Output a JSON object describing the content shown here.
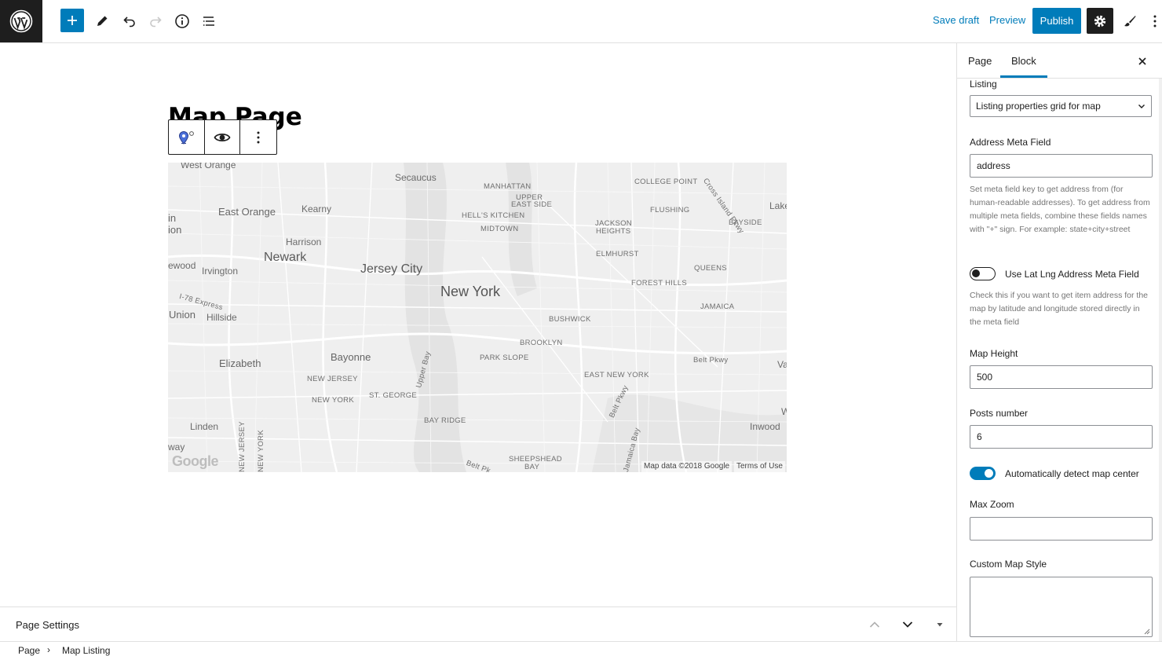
{
  "toolbar": {
    "save_draft": "Save draft",
    "preview": "Preview",
    "publish": "Publish"
  },
  "editor": {
    "page_title": "Map Page"
  },
  "map": {
    "labels": [
      {
        "text": "West Orange",
        "cls": "mid"
      },
      {
        "text": "Secaucus",
        "cls": ""
      },
      {
        "text": "MANHATTAN",
        "cls": "hood"
      },
      {
        "text": "UPPER",
        "cls": "hood"
      },
      {
        "text": "EAST SIDE",
        "cls": "hood"
      },
      {
        "text": "COLLEGE POINT",
        "cls": "hood"
      },
      {
        "text": "Cross Island Pkwy",
        "cls": "hood"
      },
      {
        "text": "Lake",
        "cls": ""
      },
      {
        "text": "in",
        "cls": "mid"
      },
      {
        "text": "ion",
        "cls": "mid"
      },
      {
        "text": "East Orange",
        "cls": "mid"
      },
      {
        "text": "Kearny",
        "cls": ""
      },
      {
        "text": "HELL'S KITCHEN",
        "cls": "hood"
      },
      {
        "text": "MIDTOWN",
        "cls": "hood"
      },
      {
        "text": "FLUSHING",
        "cls": "hood"
      },
      {
        "text": "JACKSON",
        "cls": "hood"
      },
      {
        "text": "HEIGHTS",
        "cls": "hood"
      },
      {
        "text": "BAYSIDE",
        "cls": "hood"
      },
      {
        "text": "Harrison",
        "cls": ""
      },
      {
        "text": "Newark",
        "cls": "city"
      },
      {
        "text": "ELMHURST",
        "cls": "hood"
      },
      {
        "text": "ewood",
        "cls": ""
      },
      {
        "text": "Irvington",
        "cls": ""
      },
      {
        "text": "Jersey City",
        "cls": "city"
      },
      {
        "text": "QUEENS",
        "cls": "hood"
      },
      {
        "text": "FOREST HILLS",
        "cls": "hood"
      },
      {
        "text": "New York",
        "cls": "big"
      },
      {
        "text": "I-78 Express",
        "cls": "hood"
      },
      {
        "text": "JAMAICA",
        "cls": "hood"
      },
      {
        "text": "Union",
        "cls": "mid"
      },
      {
        "text": "Hillside",
        "cls": ""
      },
      {
        "text": "BUSHWICK",
        "cls": "hood"
      },
      {
        "text": "BROOKLYN",
        "cls": "hood"
      },
      {
        "text": "Elizabeth",
        "cls": "mid"
      },
      {
        "text": "Bayonne",
        "cls": "mid"
      },
      {
        "text": "PARK SLOPE",
        "cls": "hood"
      },
      {
        "text": "Upper Bay",
        "cls": "hood"
      },
      {
        "text": "Belt Pkwy",
        "cls": "hood"
      },
      {
        "text": "Va",
        "cls": ""
      },
      {
        "text": "NEW JERSEY",
        "cls": "hood"
      },
      {
        "text": "EAST NEW YORK",
        "cls": "hood"
      },
      {
        "text": "NEW YORK",
        "cls": "hood"
      },
      {
        "text": "ST. GEORGE",
        "cls": "hood"
      },
      {
        "text": "Belt Pkwy",
        "cls": "hood"
      },
      {
        "text": "W",
        "cls": ""
      },
      {
        "text": "BAY RIDGE",
        "cls": "hood"
      },
      {
        "text": "Linden",
        "cls": ""
      },
      {
        "text": "Inwood",
        "cls": ""
      },
      {
        "text": "way",
        "cls": ""
      },
      {
        "text": "NEW JERSEY",
        "cls": "hood"
      },
      {
        "text": "NEW YORK",
        "cls": "hood"
      },
      {
        "text": "Jamaica Bay",
        "cls": "hood"
      },
      {
        "text": "SHEEPSHEAD",
        "cls": "hood"
      },
      {
        "text": "BAY",
        "cls": "hood"
      },
      {
        "text": "Belt Pk",
        "cls": "hood"
      }
    ],
    "google_logo": "Google",
    "attribution": "Map data ©2018 Google",
    "terms": "Terms of Use"
  },
  "bottom": {
    "page_settings": "Page Settings",
    "breadcrumb_page": "Page",
    "breadcrumb_current": "Map Listing"
  },
  "sidebar": {
    "tab_page": "Page",
    "tab_block": "Block",
    "listing_label": "Listing",
    "listing_value": "Listing properties grid for map",
    "address_label": "Address Meta Field",
    "address_value": "address",
    "address_help": "Set meta field key to get address from (for human-readable addresses). To get address from multiple meta fields, combine these fields names with \"+\" sign. For example: state+city+street",
    "latlng_label": "Use Lat Lng Address Meta Field",
    "latlng_help": "Check this if you want to get item address for the map by latitude and longitude stored directly in the meta field",
    "height_label": "Map Height",
    "height_value": "500",
    "posts_label": "Posts number",
    "posts_value": "6",
    "autocenter_label": "Automatically detect map center",
    "maxzoom_label": "Max Zoom",
    "maxzoom_value": "",
    "style_label": "Custom Map Style"
  },
  "colors": {
    "accent": "#007cba",
    "dark": "#1e1e1e"
  }
}
